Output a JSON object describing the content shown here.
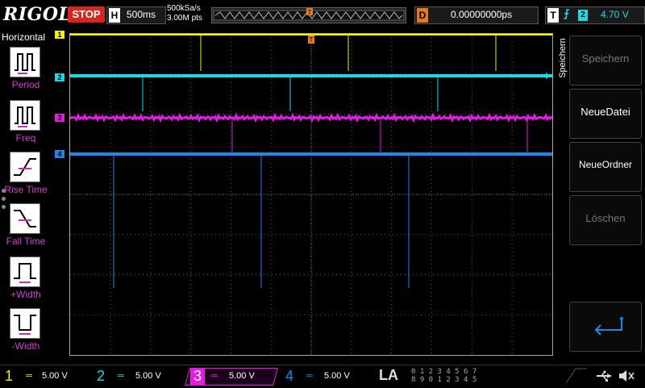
{
  "header": {
    "logo": "RIGOL",
    "run_status": "STOP",
    "horizontal_label": "H",
    "timebase": "500ms",
    "sample_rate": "500kSa/s",
    "memory_depth": "3.00M pts",
    "delay_label": "D",
    "delay_value": "0.00000000ps",
    "trigger_label": "T",
    "trigger_edge_icon": "rising-edge-icon",
    "trigger_source": "2",
    "trigger_level": "4.70 V"
  },
  "left_panel": {
    "title": "Horizontal",
    "items": [
      {
        "label": "Period",
        "icon": "period-icon"
      },
      {
        "label": "Freq",
        "icon": "freq-icon"
      },
      {
        "label": "Rise Time",
        "icon": "rise-time-icon"
      },
      {
        "label": "Fall Time",
        "icon": "fall-time-icon"
      },
      {
        "label": "+Width",
        "icon": "positive-width-icon"
      },
      {
        "label": "-Width",
        "icon": "negative-width-icon"
      }
    ]
  },
  "right_panel": {
    "side_title": "Speichern",
    "buttons": [
      {
        "label": "Speichern",
        "enabled": false
      },
      {
        "label": "NeueDatei",
        "enabled": true
      },
      {
        "label": "NeueOrdner",
        "enabled": true
      },
      {
        "label": "Löschen",
        "enabled": false
      },
      {
        "label": "",
        "icon": "enter-return-icon"
      }
    ]
  },
  "channels": [
    {
      "id": "1",
      "color": "#f5f20a",
      "scale": "5.00 V"
    },
    {
      "id": "2",
      "color": "#1ed8e8",
      "scale": "5.00 V"
    },
    {
      "id": "3",
      "color": "#e01ee0",
      "scale": "5.00 V"
    },
    {
      "id": "4",
      "color": "#1e8ae8",
      "scale": "5.00 V"
    }
  ],
  "bottom": {
    "la_label": "LA",
    "la_row1": "0 1 2 3 4 5 6 7",
    "la_row2": "8 9 0 1 2 3 4 5",
    "usb_icon": "usb-icon",
    "speaker_icon": "speaker-muted-icon"
  }
}
